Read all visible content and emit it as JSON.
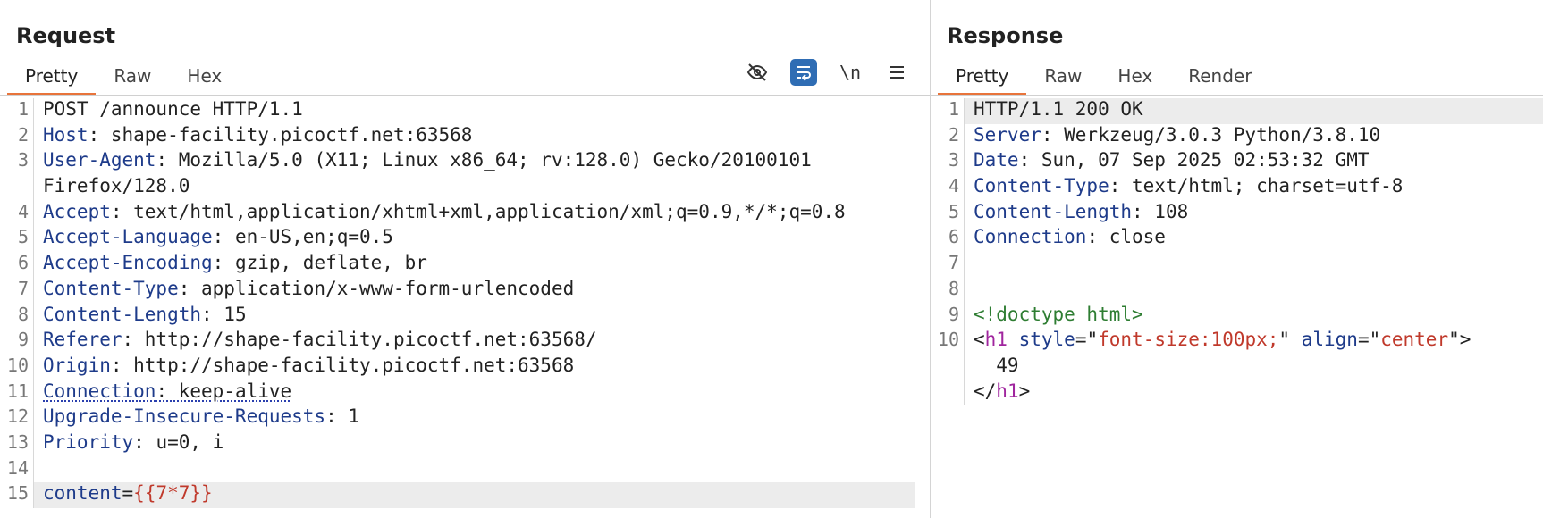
{
  "request": {
    "title": "Request",
    "tabs": [
      "Pretty",
      "Raw",
      "Hex"
    ],
    "tools": [
      {
        "name": "hide-icon"
      },
      {
        "name": "wrap-icon",
        "active": true
      },
      {
        "name": "newline",
        "text": "\\n"
      },
      {
        "name": "menu-icon"
      }
    ],
    "lines": {
      "l1": "POST /announce HTTP/1.1",
      "l2k": "Host",
      "l2v": ": shape-facility.picoctf.net:63568",
      "l3k": "User-Agent",
      "l3v": ": Mozilla/5.0 (X11; Linux x86_64; rv:128.0) Gecko/20100101",
      "l3c": "Firefox/128.0",
      "l4k": "Accept",
      "l4v": ": text/html,application/xhtml+xml,application/xml;q=0.9,*/*;q=0.8",
      "l5k": "Accept-Language",
      "l5v": ": en-US,en;q=0.5",
      "l6k": "Accept-Encoding",
      "l6v": ": gzip, deflate, br",
      "l7k": "Content-Type",
      "l7v": ": application/x-www-form-urlencoded",
      "l8k": "Content-Length",
      "l8v": ": 15",
      "l9k": "Referer",
      "l9v": ": http://shape-facility.picoctf.net:63568/",
      "l10k": "Origin",
      "l10v": ": http://shape-facility.picoctf.net:63568",
      "l11k": "Connection",
      "l11v": ": keep-alive",
      "l12k": "Upgrade-Insecure-Requests",
      "l12v": ": 1",
      "l13k": "Priority",
      "l13v": ": u=0, i",
      "l15k": "content",
      "l15e": "=",
      "l15v": "{{7*7}}"
    }
  },
  "response": {
    "title": "Response",
    "tabs": [
      "Pretty",
      "Raw",
      "Hex",
      "Render"
    ],
    "lines": {
      "l1": "HTTP/1.1 200 OK",
      "l2k": "Server",
      "l2v": ": Werkzeug/3.0.3 Python/3.8.10",
      "l3k": "Date",
      "l3v": ": Sun, 07 Sep 2025 02:53:32 GMT",
      "l4k": "Content-Type",
      "l4v": ": text/html; charset=utf-8",
      "l5k": "Content-Length",
      "l5v": ": 108",
      "l6k": "Connection",
      "l6v": ": close",
      "l9": "<!doctype html>",
      "l10a": "<",
      "l10tag": "h1",
      "l10b": " ",
      "l10attr1": "style",
      "l10eq1": "=\"",
      "l10val1": "font-size:100px;",
      "l10q1": "\" ",
      "l10attr2": "align",
      "l10eq2": "=\"",
      "l10val2": "center",
      "l10q2": "\">",
      "l10c1": "  49",
      "l10c2a": "</",
      "l10c2tag": "h1",
      "l10c2b": ">"
    }
  },
  "line_numbers": [
    "1",
    "2",
    "3",
    "4",
    "5",
    "6",
    "7",
    "8",
    "9",
    "10",
    "11",
    "12",
    "13",
    "14",
    "15"
  ]
}
